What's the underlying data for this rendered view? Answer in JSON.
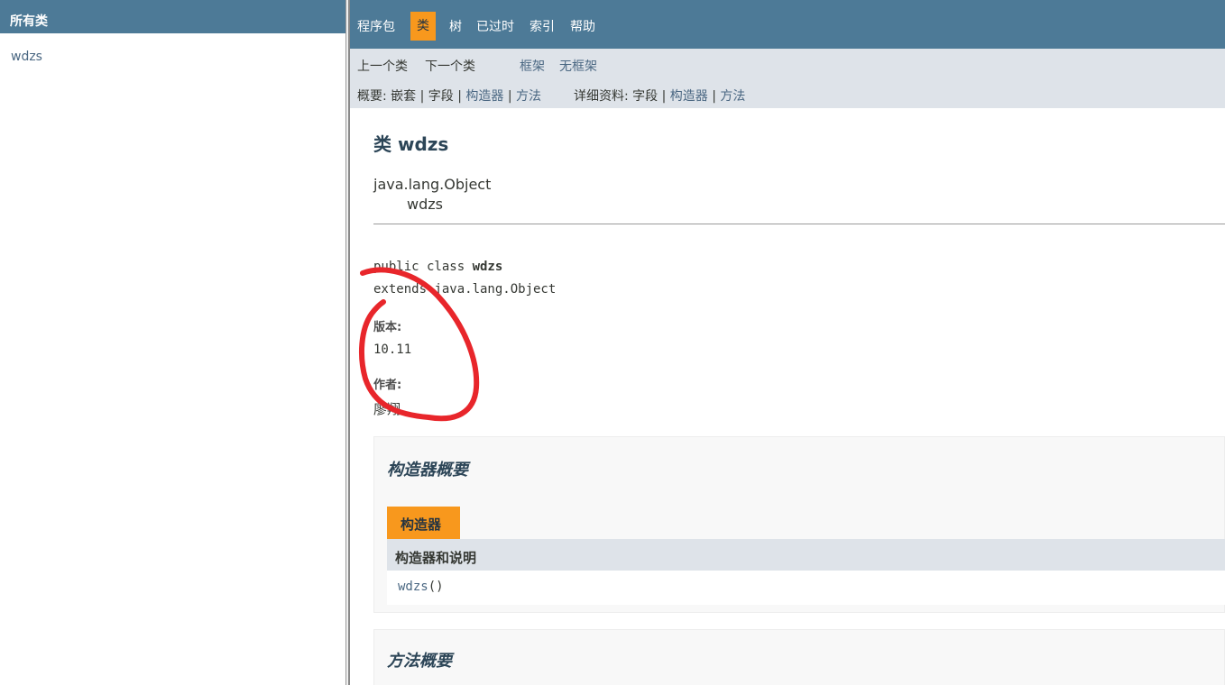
{
  "left": {
    "header": "所有类",
    "classes": [
      "wdzs"
    ]
  },
  "topnav": {
    "items": [
      "程序包",
      "类",
      "树",
      "已过时",
      "索引",
      "帮助"
    ],
    "active": "类"
  },
  "subnav": {
    "prev_class": "上一个类",
    "next_class": "下一个类",
    "frames": "框架",
    "no_frames": "无框架",
    "summary_label": "概要:",
    "summary_nested": "嵌套",
    "summary_field": "字段",
    "summary_constr": "构造器",
    "summary_method": "方法",
    "detail_label": "详细资料:",
    "detail_field": "字段",
    "detail_constr": "构造器",
    "detail_method": "方法",
    "separator": "|"
  },
  "class_info": {
    "title": "类 wdzs",
    "inherit_parent": "java.lang.Object",
    "inherit_child": "wdzs",
    "decl_line1_prefix": "public class ",
    "decl_line1_name": "wdzs",
    "decl_line2": "extends java.lang.Object",
    "version_label": "版本:",
    "version_value": "10.11",
    "author_label": "作者:",
    "author_value": "廖翔"
  },
  "constructor_summary": {
    "title": "构造器概要",
    "tab": "构造器",
    "column_header": "构造器和说明",
    "rows": [
      {
        "name": "wdzs",
        "params": "()"
      }
    ]
  },
  "method_summary": {
    "title": "方法概要"
  },
  "colors": {
    "nav_bg": "#4d7a97",
    "accent": "#f8981d",
    "subnav_bg": "#dee3e9",
    "annotation": "#e8262b"
  }
}
